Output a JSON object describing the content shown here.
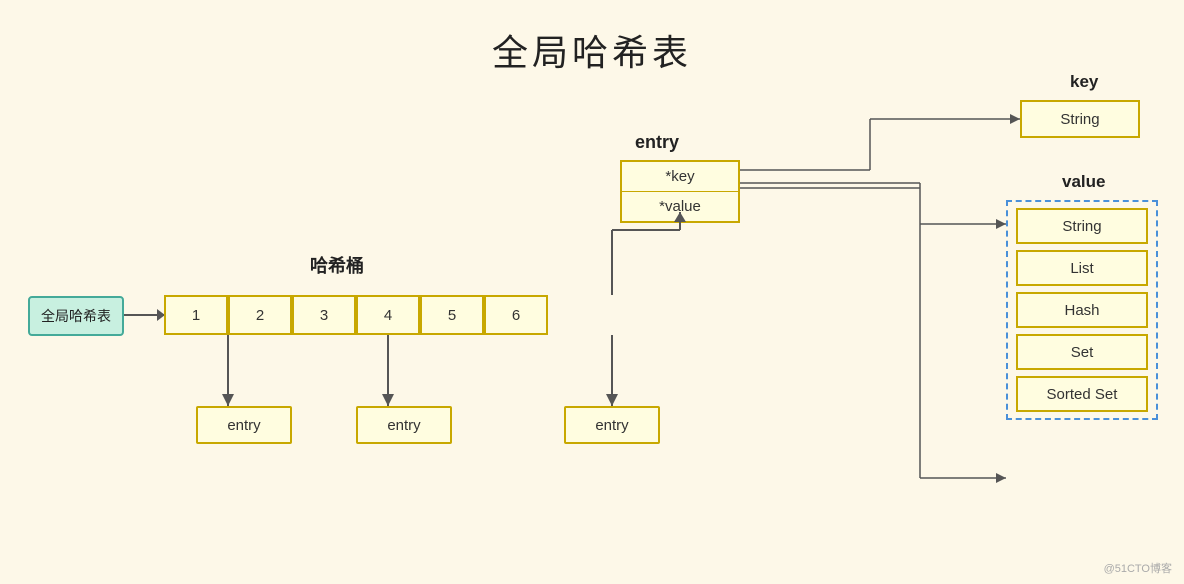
{
  "title": "全局哈希表",
  "globalHT": {
    "label": "全局哈希表"
  },
  "bucketSection": {
    "label": "哈希桶",
    "cells": [
      "1",
      "2",
      "3",
      "4",
      "5",
      "6"
    ]
  },
  "entryDetail": {
    "label": "entry",
    "rows": [
      "*key",
      "*value"
    ]
  },
  "entryBoxes": [
    {
      "label": "entry"
    },
    {
      "label": "entry"
    },
    {
      "label": "entry"
    }
  ],
  "keySection": {
    "label": "key",
    "box": "String"
  },
  "valueSection": {
    "label": "value",
    "items": [
      "String",
      "List",
      "Hash",
      "Set",
      "Sorted Set"
    ]
  },
  "watermark": "@51CTO博客"
}
